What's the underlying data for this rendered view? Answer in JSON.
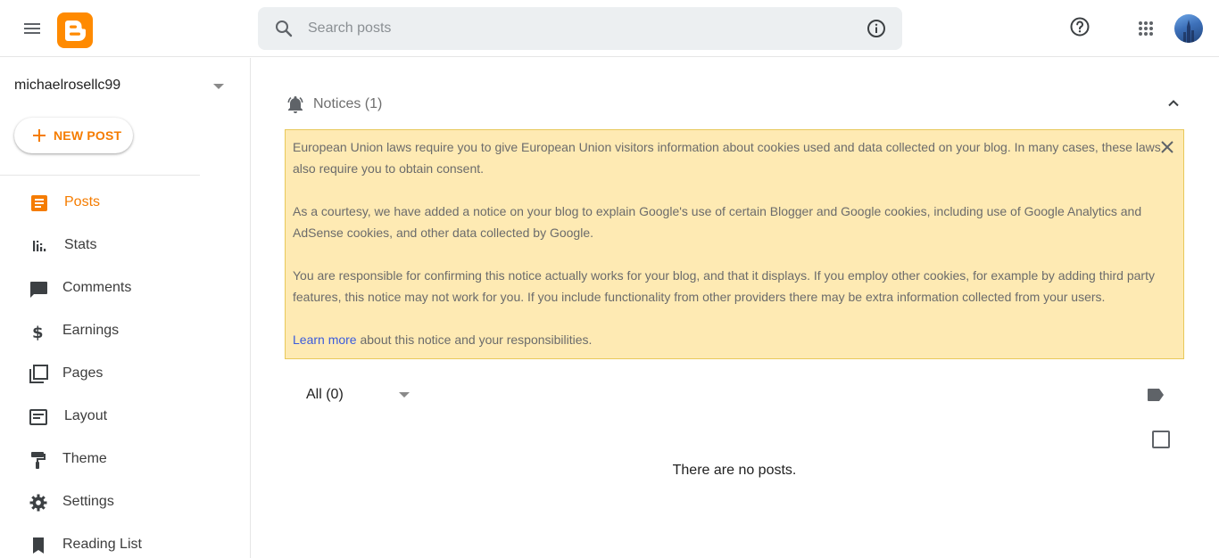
{
  "header": {
    "search_placeholder": "Search posts"
  },
  "sidebar": {
    "blog_name": "michaelrosellc99",
    "new_post_label": "NEW POST",
    "items": [
      {
        "label": "Posts",
        "icon": "posts-icon"
      },
      {
        "label": "Stats",
        "icon": "stats-icon"
      },
      {
        "label": "Comments",
        "icon": "comments-icon"
      },
      {
        "label": "Earnings",
        "icon": "dollar-icon"
      },
      {
        "label": "Pages",
        "icon": "pages-icon"
      },
      {
        "label": "Layout",
        "icon": "layout-icon"
      },
      {
        "label": "Theme",
        "icon": "paint-roller-icon"
      },
      {
        "label": "Settings",
        "icon": "gear-icon"
      },
      {
        "label": "Reading List",
        "icon": "bookmark-icon"
      }
    ]
  },
  "notices": {
    "title": "Notices (1)",
    "p1": "European Union laws require you to give European Union visitors information about cookies used and data collected on your blog. In many cases, these laws also require you to obtain consent.",
    "p2": "As a courtesy, we have added a notice on your blog to explain Google's use of certain Blogger and Google cookies, including use of Google Analytics and AdSense cookies, and other data collected by Google.",
    "p3": "You are responsible for confirming this notice actually works for your blog, and that it displays. If you employ other cookies, for example by adding third party features, this notice may not work for you. If you include functionality from other providers there may be extra information collected from your users.",
    "learn_more": "Learn more",
    "p4_rest": " about this notice and your responsibilities."
  },
  "posts": {
    "filter_label": "All (0)",
    "empty_message": "There are no posts."
  },
  "colors": {
    "accent": "#f57c00",
    "notice_bg": "#feeab3",
    "link": "#3b5bdb"
  }
}
